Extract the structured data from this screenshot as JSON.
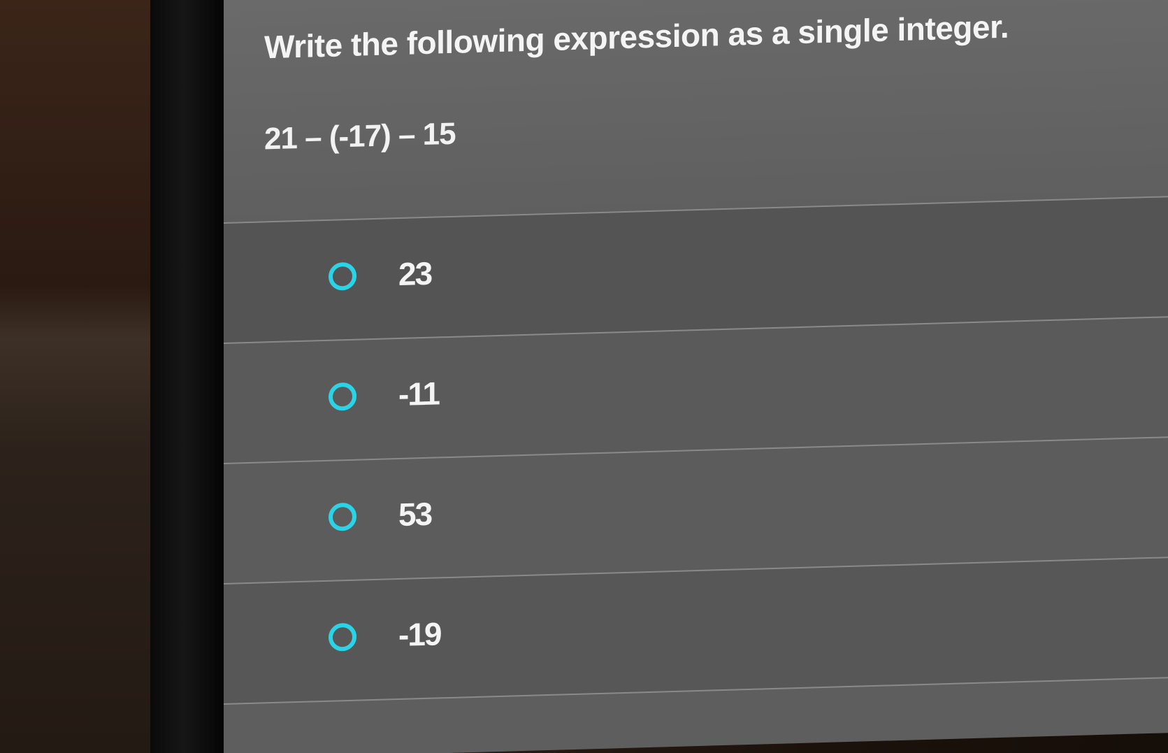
{
  "question": {
    "title": "Write the following expression as a single integer.",
    "expression": "21 – (-17) – 15"
  },
  "options": [
    {
      "label": "23"
    },
    {
      "label": "-11"
    },
    {
      "label": "53"
    },
    {
      "label": "-19"
    }
  ],
  "colors": {
    "radio_accent": "#2ad4e6",
    "panel_background": "#595959",
    "text": "#f4f4f4"
  }
}
